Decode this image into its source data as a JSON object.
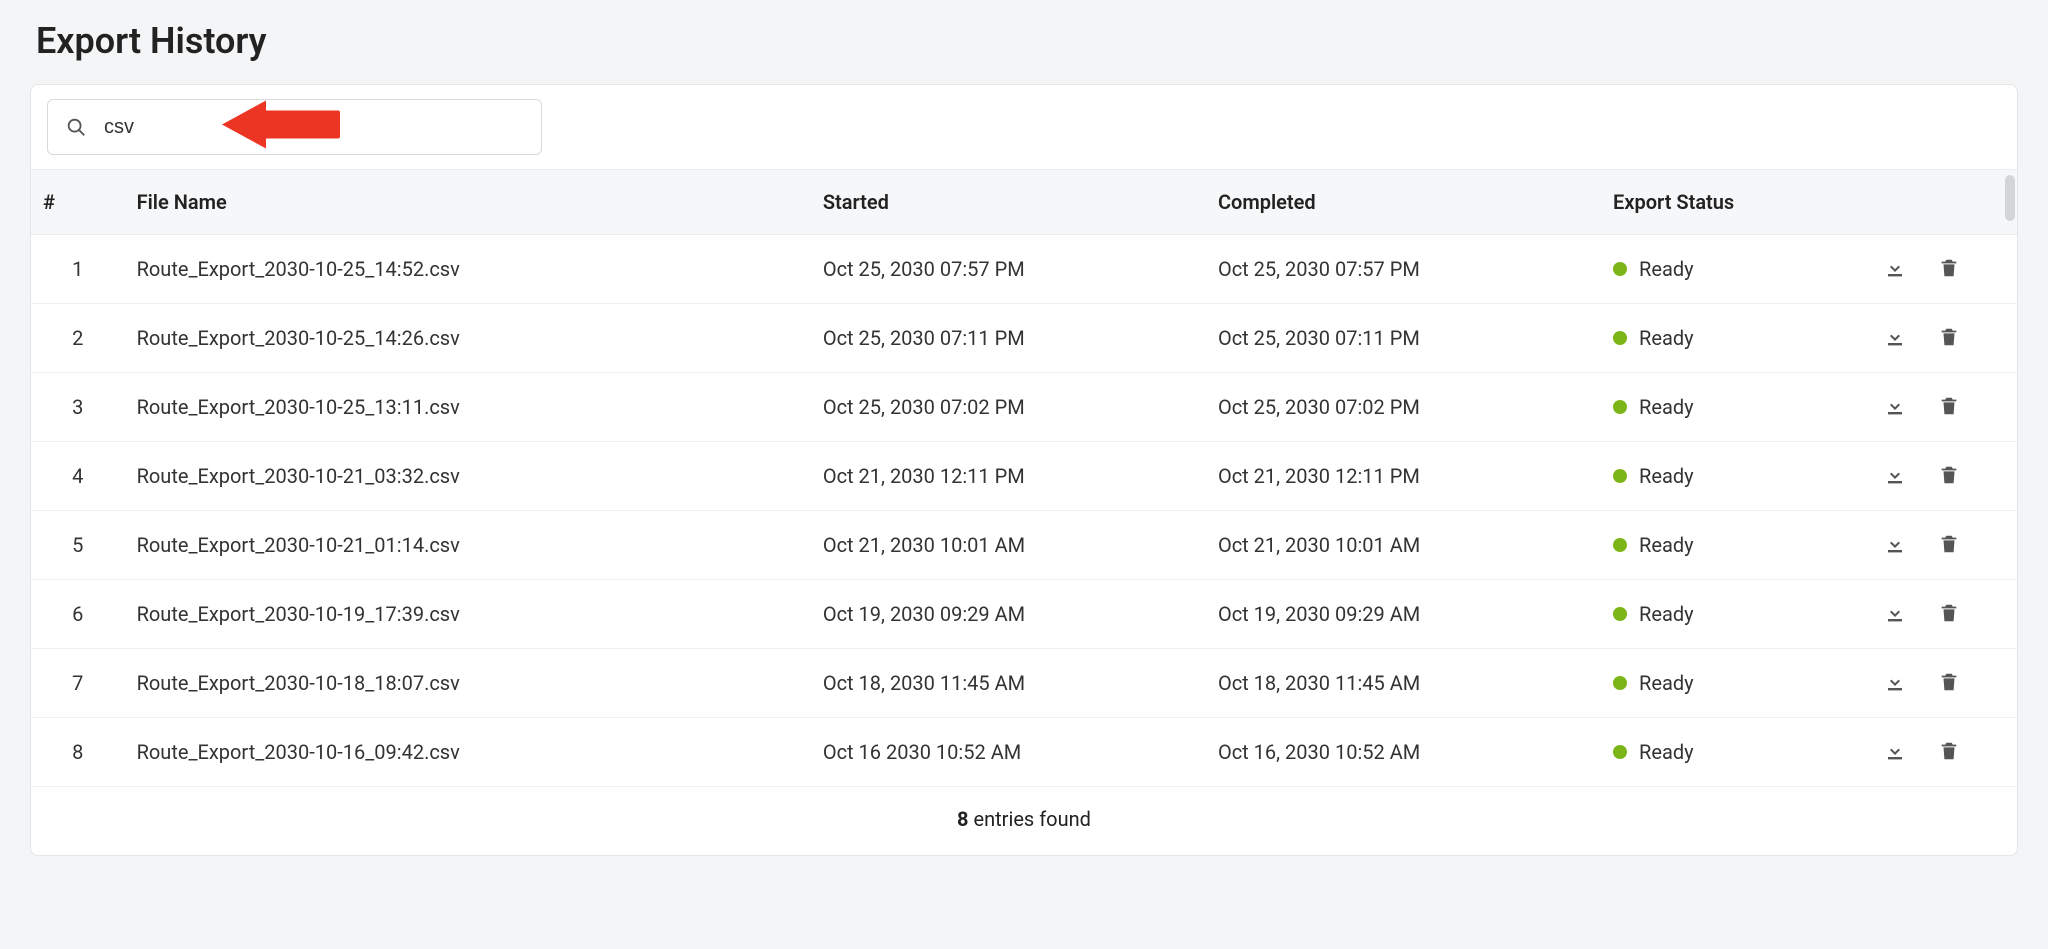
{
  "page": {
    "title": "Export History"
  },
  "search": {
    "value": "csv",
    "placeholder": ""
  },
  "table": {
    "headers": {
      "index": "#",
      "file_name": "File Name",
      "started": "Started",
      "completed": "Completed",
      "status": "Export Status"
    },
    "rows": [
      {
        "index": "1",
        "file_name": "Route_Export_2030-10-25_14:52.csv",
        "started": "Oct 25, 2030 07:57 PM",
        "completed": "Oct 25, 2030 07:57 PM",
        "status": "Ready"
      },
      {
        "index": "2",
        "file_name": "Route_Export_2030-10-25_14:26.csv",
        "started": "Oct 25, 2030 07:11 PM",
        "completed": "Oct 25, 2030 07:11 PM",
        "status": "Ready"
      },
      {
        "index": "3",
        "file_name": "Route_Export_2030-10-25_13:11.csv",
        "started": "Oct 25, 2030 07:02 PM",
        "completed": "Oct 25, 2030 07:02 PM",
        "status": "Ready"
      },
      {
        "index": "4",
        "file_name": "Route_Export_2030-10-21_03:32.csv",
        "started": "Oct 21, 2030 12:11 PM",
        "completed": "Oct 21, 2030 12:11 PM",
        "status": "Ready"
      },
      {
        "index": "5",
        "file_name": "Route_Export_2030-10-21_01:14.csv",
        "started": "Oct 21, 2030 10:01 AM",
        "completed": "Oct 21, 2030 10:01 AM",
        "status": "Ready"
      },
      {
        "index": "6",
        "file_name": "Route_Export_2030-10-19_17:39.csv",
        "started": "Oct 19, 2030 09:29 AM",
        "completed": "Oct 19, 2030 09:29 AM",
        "status": "Ready"
      },
      {
        "index": "7",
        "file_name": "Route_Export_2030-10-18_18:07.csv",
        "started": "Oct 18, 2030 11:45 AM",
        "completed": "Oct 18, 2030 11:45 AM",
        "status": "Ready"
      },
      {
        "index": "8",
        "file_name": "Route_Export_2030-10-16_09:42.csv",
        "started": "Oct 16 2030 10:52 AM",
        "completed": "Oct 16, 2030 10:52 AM",
        "status": "Ready"
      }
    ],
    "footer": {
      "count": "8",
      "suffix": " entries found"
    }
  },
  "colors": {
    "status_ready": "#7cb518",
    "annotation": "#ed3524"
  }
}
